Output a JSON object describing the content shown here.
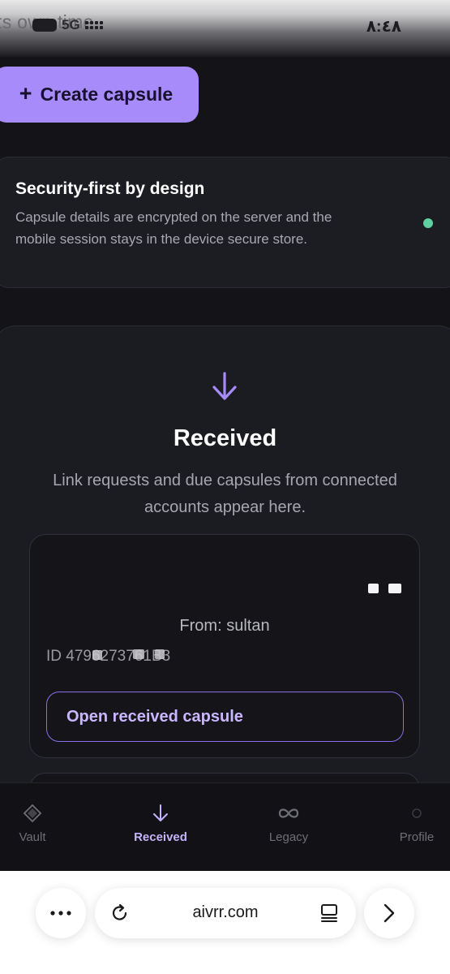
{
  "status_bar": {
    "overlay_text": "ts own time",
    "network": "5G",
    "time": "٨:٤٨"
  },
  "main": {
    "create_button": {
      "icon": "plus-icon",
      "label": "Create capsule"
    },
    "security_card": {
      "title": "Security-first by design",
      "text": "Capsule details are encrypted on the server and the mobile session stays in the device secure store.",
      "status_color": "#5fd0a0"
    },
    "received_section": {
      "icon": "arrow-down-icon",
      "title": "Received",
      "subtitle": "Link requests and due capsules from connected accounts appear here.",
      "capsule": {
        "from": "From: sultan",
        "id": "ID 4796273761B3",
        "open_button": "Open received capsule"
      }
    }
  },
  "bottom_nav": {
    "items": [
      {
        "icon": "diamond-icon",
        "label": "Vault",
        "active": false
      },
      {
        "icon": "arrow-down-icon",
        "label": "Received",
        "active": true
      },
      {
        "icon": "infinity-icon",
        "label": "Legacy",
        "active": false
      },
      {
        "icon": "profile-icon",
        "label": "Profile",
        "active": false
      }
    ]
  },
  "browser": {
    "url": "aivrr.com",
    "buttons": [
      "more-icon",
      "reload-icon",
      "tabs-icon",
      "forward-icon"
    ]
  },
  "colors": {
    "accent": "#a78bfa",
    "background": "#131318",
    "card": "#1b1b22",
    "active_nav": "#c6b3ff"
  }
}
